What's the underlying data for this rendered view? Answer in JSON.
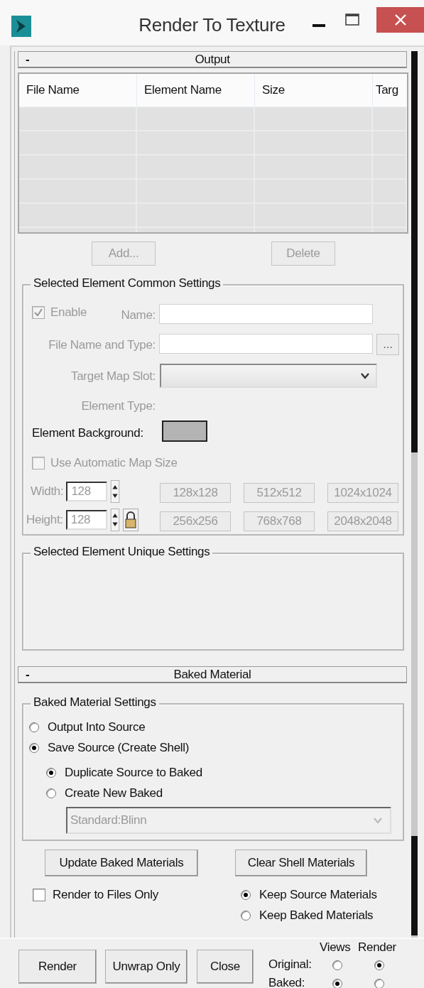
{
  "window": {
    "title": "Render To Texture"
  },
  "output": {
    "collapse": "-",
    "title": "Output",
    "table": {
      "columns": [
        "File Name",
        "Element Name",
        "Size",
        "Targ"
      ]
    },
    "buttons": [
      {
        "label": "Add...",
        "disabled": true
      },
      {
        "label": "Delete",
        "disabled": true
      }
    ],
    "common_settings": {
      "title": "Selected Element Common Settings",
      "enable": {
        "label": "Enable",
        "checked": true,
        "disabled": true
      },
      "name_label": "Name:",
      "file_label": "File Name and Type:",
      "browse": "...",
      "target_label": "Target Map Slot:",
      "element_type_label": "Element Type:",
      "background_label": "Element Background:",
      "auto_size": {
        "label": "Use Automatic Map Size",
        "checked": false,
        "disabled": true
      },
      "width": {
        "label": "Width:",
        "value": "128"
      },
      "height": {
        "label": "Height:",
        "value": "128"
      },
      "presets": [
        {
          "label": "128x128",
          "disabled": true
        },
        {
          "label": "512x512",
          "disabled": true
        },
        {
          "label": "1024x1024",
          "disabled": true
        },
        {
          "label": "256x256",
          "disabled": true
        },
        {
          "label": "768x768",
          "disabled": true
        },
        {
          "label": "2048x2048",
          "disabled": true
        }
      ]
    },
    "unique_settings": {
      "title": "Selected Element Unique Settings"
    }
  },
  "baked_material": {
    "collapse": "-",
    "title": "Baked Material",
    "settings": {
      "title": "Baked Material Settings",
      "options": [
        {
          "label": "Output Into Source",
          "selected": false
        },
        {
          "label": "Save Source (Create Shell)",
          "selected": true
        }
      ],
      "sub_options": [
        {
          "label": "Duplicate Source to Baked",
          "selected": true
        },
        {
          "label": "Create New Baked",
          "selected": false
        }
      ],
      "material": "Standard:Blinn"
    },
    "buttons": [
      "Update Baked Materials",
      "Clear Shell Materials"
    ],
    "render_to_files": {
      "label": "Render to Files Only",
      "checked": false
    },
    "keep": [
      {
        "label": "Keep Source Materials",
        "selected": true
      },
      {
        "label": "Keep Baked Materials",
        "selected": false
      }
    ]
  },
  "footer": {
    "buttons": [
      "Render",
      "Unwrap Only",
      "Close"
    ],
    "columns": [
      "Views",
      "Render"
    ],
    "rows": [
      {
        "label": "Original:",
        "views": false,
        "render": true
      },
      {
        "label": "Baked:",
        "views": true,
        "render": false
      }
    ]
  }
}
